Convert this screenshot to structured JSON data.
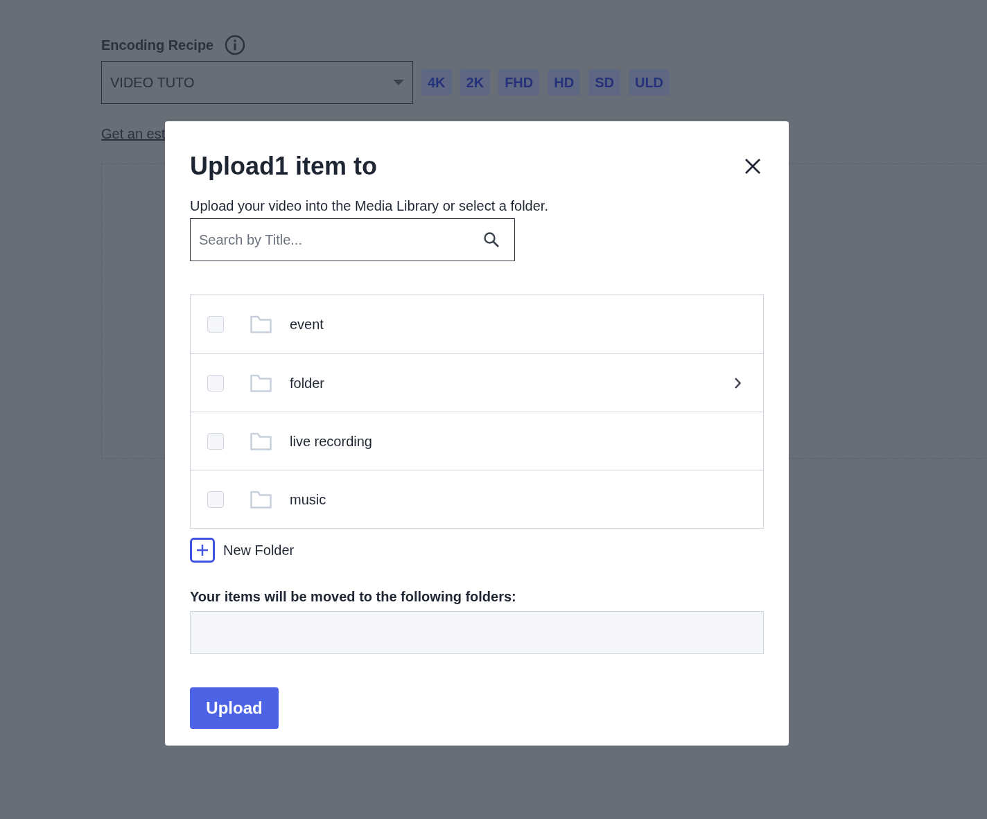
{
  "background_page": {
    "recipe_label": "Encoding Recipe",
    "recipe_select": {
      "value": "VIDEO TUTO"
    },
    "quality_chips": [
      "4K",
      "2K",
      "FHD",
      "HD",
      "SD",
      "ULD"
    ],
    "estimate_link": "Get an est"
  },
  "dialog": {
    "title": "Upload1 item to",
    "subtitle": "Upload your video into the Media Library or select a folder.",
    "search": {
      "placeholder": "Search by Title..."
    },
    "folders": [
      {
        "name": "event",
        "checked": false,
        "has_children": false
      },
      {
        "name": "folder",
        "checked": false,
        "has_children": true
      },
      {
        "name": "live recording",
        "checked": false,
        "has_children": false
      },
      {
        "name": "music",
        "checked": false,
        "has_children": false
      }
    ],
    "new_folder": "New Folder",
    "destination_label": "Your items will be moved to the following folders:",
    "upload_button": "Upload"
  }
}
